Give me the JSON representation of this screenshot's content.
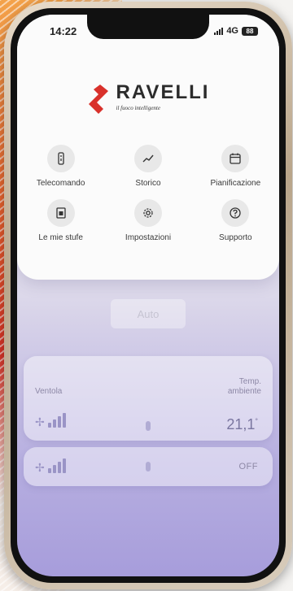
{
  "status_bar": {
    "time": "14:22",
    "network": "4G",
    "battery": "88"
  },
  "brand": {
    "name": "RAVELLI",
    "tagline": "il fuoco intelligente",
    "accent": "#d9312b"
  },
  "menu": [
    {
      "label": "Telecomando",
      "icon": "remote-control-icon"
    },
    {
      "label": "Storico",
      "icon": "trend-chart-icon"
    },
    {
      "label": "Pianificazione",
      "icon": "calendar-icon"
    },
    {
      "label": "Le mie stufe",
      "icon": "stove-icon"
    },
    {
      "label": "Impostazioni",
      "icon": "gear-icon"
    },
    {
      "label": "Supporto",
      "icon": "support-icon"
    }
  ],
  "controls": {
    "mode_button": "Auto",
    "fan_label": "Ventola",
    "ambient_temp_label_line1": "Temp.",
    "ambient_temp_label_line2": "ambiente",
    "ambient_temp_value": "21,1",
    "ambient_temp_unit": "°",
    "second_row_value": "OFF"
  }
}
